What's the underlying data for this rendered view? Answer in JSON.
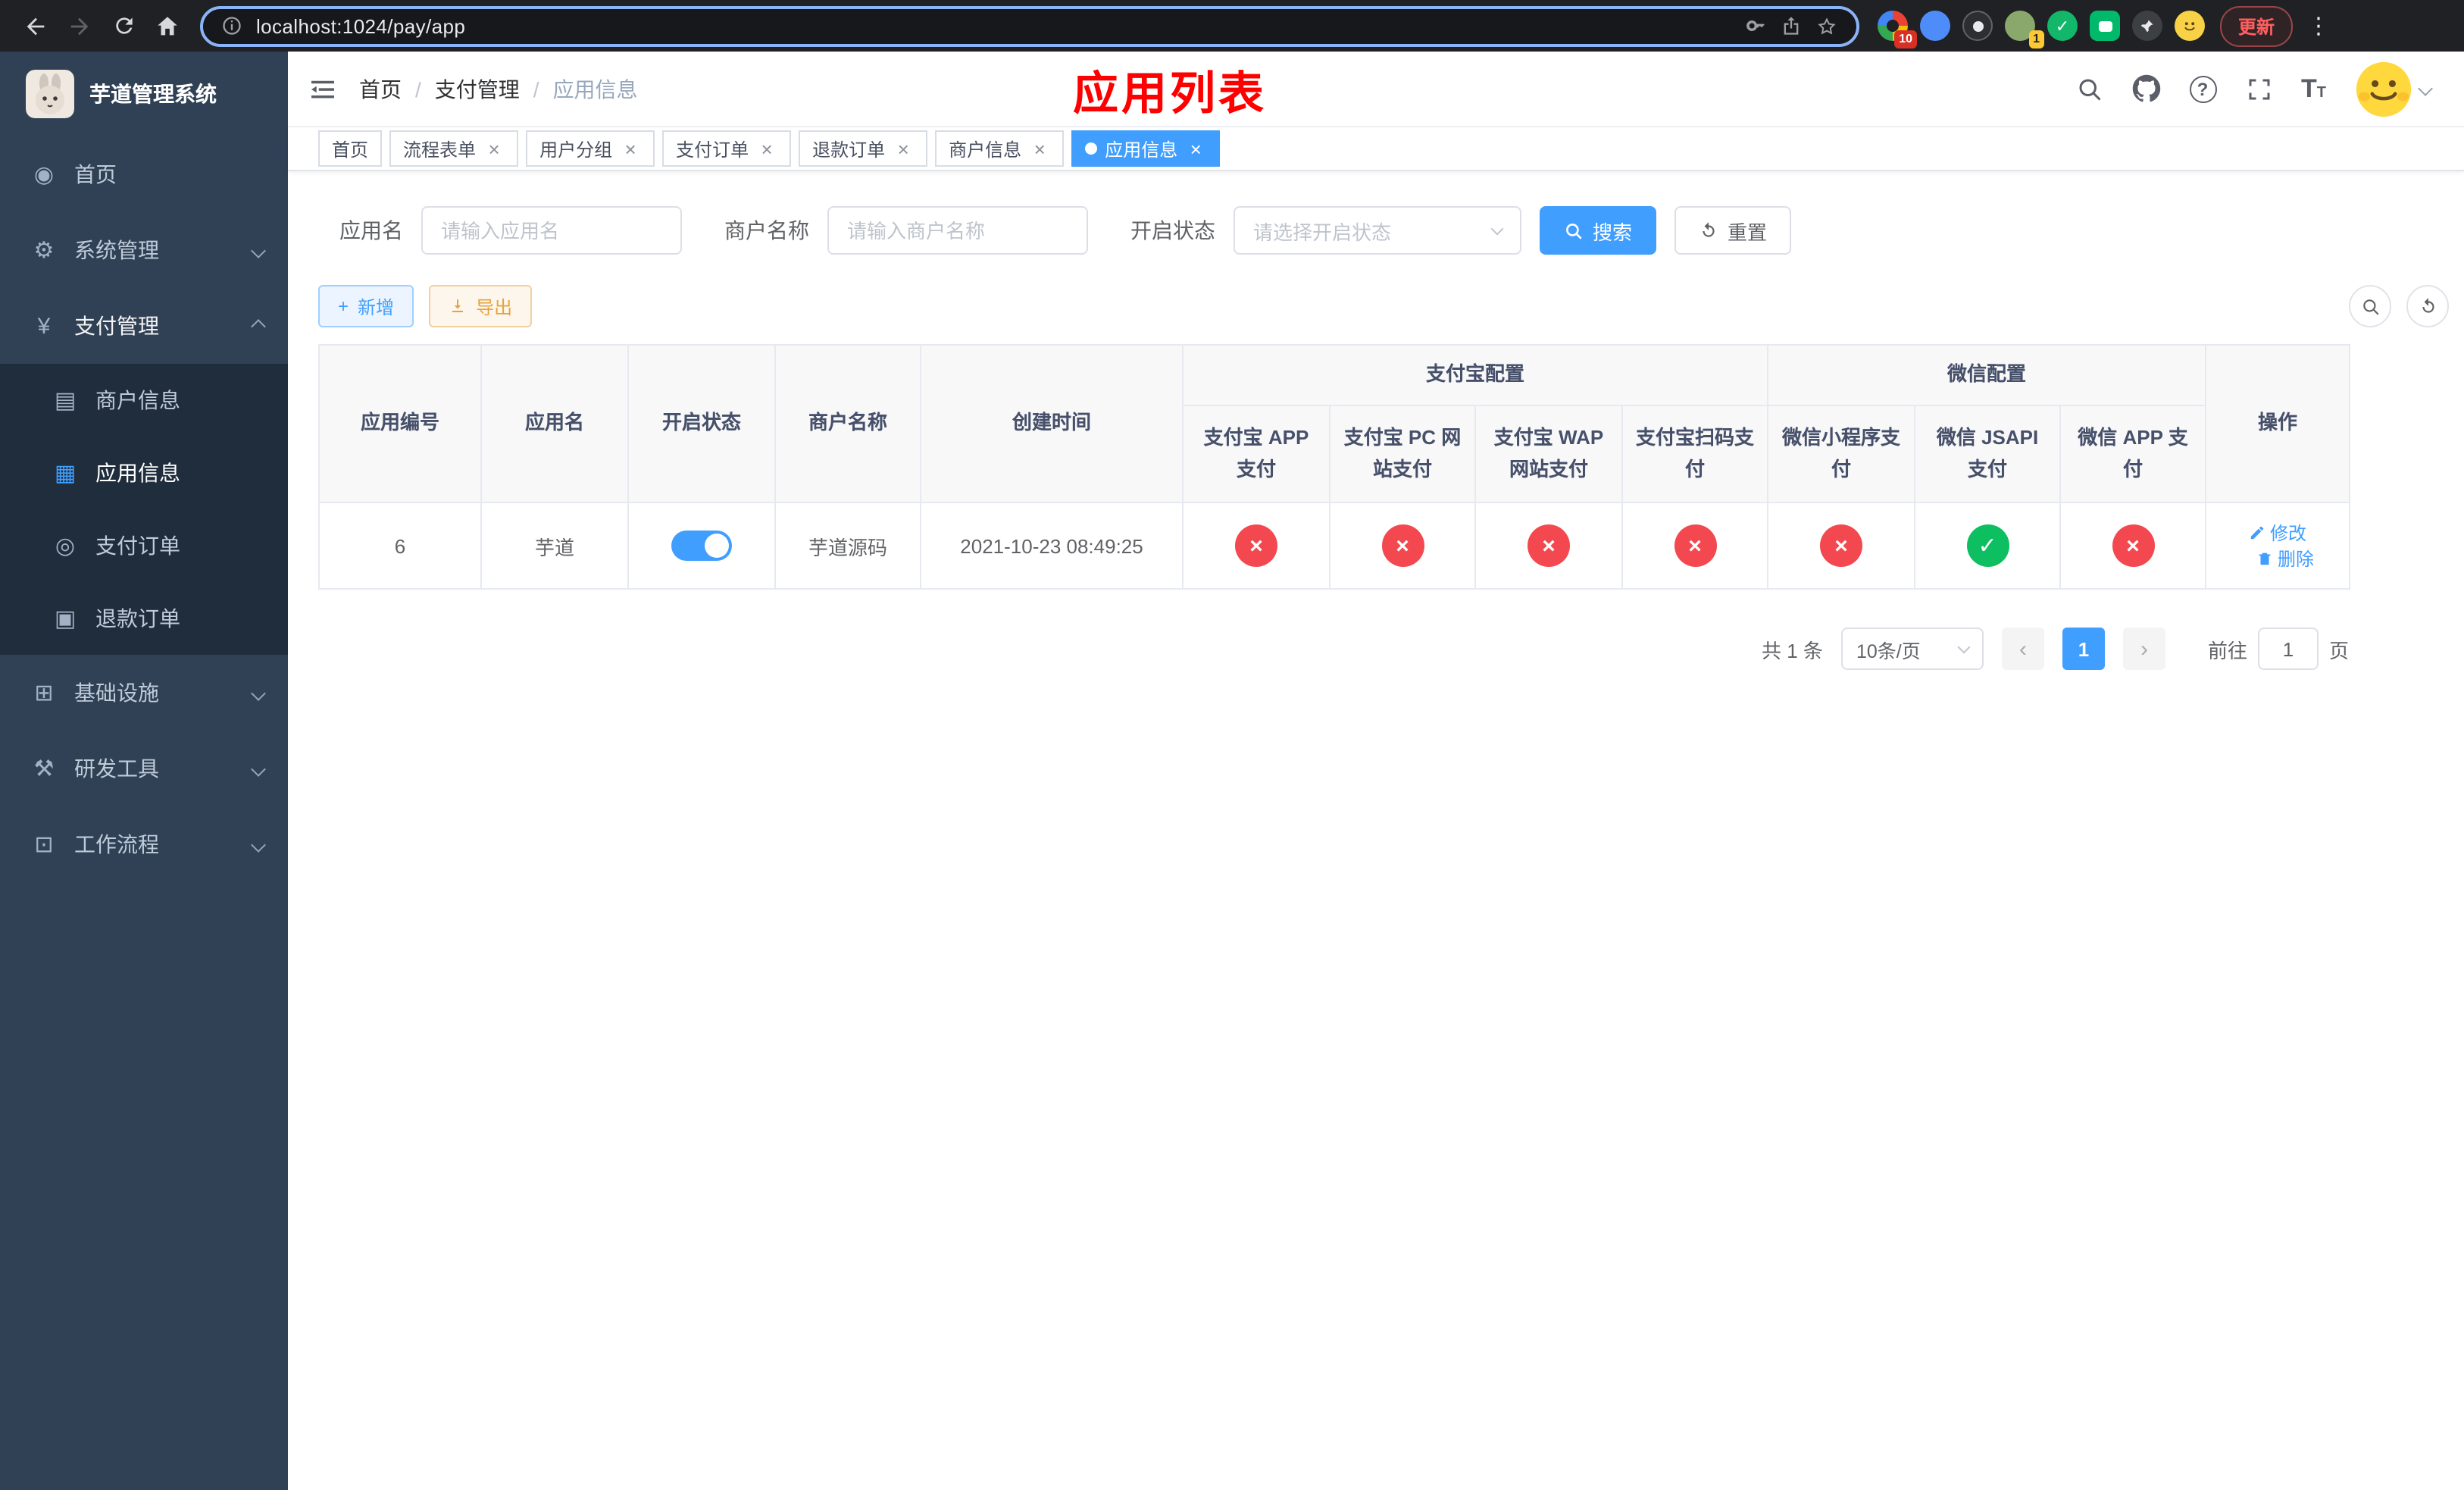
{
  "colors": {
    "primary": "#409eff",
    "success": "#0dbf61",
    "danger": "#f3484f",
    "warning": "#e6a23c",
    "page_title_red": "#ff0000",
    "sidebar_bg": "#304156",
    "submenu_bg": "#1f2d3d"
  },
  "browser": {
    "url": "localhost:1024/pay/app",
    "update_label": "更新",
    "ext_badge_first": "10",
    "ext_badge_profile": "1"
  },
  "app": {
    "title": "芋道管理系统"
  },
  "header": {
    "breadcrumb": [
      "首页",
      "支付管理",
      "应用信息"
    ],
    "page_title": "应用列表"
  },
  "sidebar": {
    "items": [
      {
        "label": "首页",
        "glyph": "◉"
      },
      {
        "label": "系统管理",
        "glyph": "⚙"
      },
      {
        "label": "支付管理",
        "glyph": "¥"
      },
      {
        "label": "基础设施",
        "glyph": "⊞"
      },
      {
        "label": "研发工具",
        "glyph": "⚒"
      },
      {
        "label": "工作流程",
        "glyph": "⊡"
      }
    ],
    "pay_submenu": [
      {
        "label": "商户信息",
        "glyph": "▤"
      },
      {
        "label": "应用信息",
        "glyph": "▦"
      },
      {
        "label": "支付订单",
        "glyph": "◎"
      },
      {
        "label": "退款订单",
        "glyph": "▣"
      }
    ]
  },
  "tabs": [
    {
      "label": "首页"
    },
    {
      "label": "流程表单"
    },
    {
      "label": "用户分组"
    },
    {
      "label": "支付订单"
    },
    {
      "label": "退款订单"
    },
    {
      "label": "商户信息"
    },
    {
      "label": "应用信息"
    }
  ],
  "filters": {
    "app_name_label": "应用名",
    "app_name_placeholder": "请输入应用名",
    "merchant_label": "商户名称",
    "merchant_placeholder": "请输入商户名称",
    "status_label": "开启状态",
    "status_placeholder": "请选择开启状态",
    "search_label": "搜索",
    "reset_label": "重置"
  },
  "toolbar": {
    "add_label": "新增",
    "export_label": "导出"
  },
  "table": {
    "groups": {
      "alipay": "支付宝配置",
      "wechat": "微信配置"
    },
    "columns": {
      "app_id": "应用编号",
      "app_name": "应用名",
      "status": "开启状态",
      "merchant": "商户名称",
      "create_time": "创建时间",
      "alipay_app": "支付宝 APP 支付",
      "alipay_pc": "支付宝 PC 网站支付",
      "alipay_wap": "支付宝 WAP 网站支付",
      "alipay_qr": "支付宝扫码支付",
      "wx_mini": "微信小程序支付",
      "wx_jsapi": "微信 JSAPI 支付",
      "wx_app": "微信 APP 支付",
      "actions": "操作"
    },
    "rows": [
      {
        "id": "6",
        "name": "芋道",
        "enabled": true,
        "merchant": "芋道源码",
        "create_time": "2021-10-23 08:49:25",
        "alipay_app": false,
        "alipay_pc": false,
        "alipay_wap": false,
        "alipay_qr": false,
        "wx_mini": false,
        "wx_jsapi": true,
        "wx_app": false
      }
    ],
    "edit_label": "修改",
    "delete_label": "删除"
  },
  "pagination": {
    "total_label": "共 1 条",
    "page_size_label": "10条/页",
    "page": "1",
    "goto_label": "前往",
    "goto_value": "1",
    "unit_label": "页"
  }
}
